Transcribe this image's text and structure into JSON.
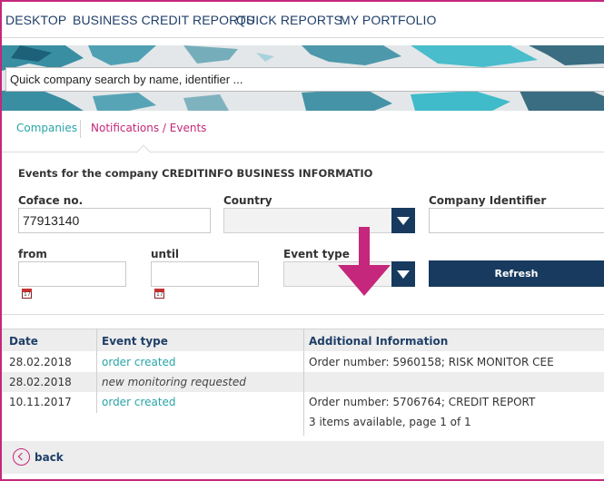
{
  "nav": {
    "items": [
      "DESKTOP",
      "BUSINESS CREDIT REPORTS",
      "QUICK REPORTS",
      "MY PORTFOLIO"
    ]
  },
  "search": {
    "placeholder": "Quick company search by name, identifier ..."
  },
  "tabs": {
    "companies": "Companies",
    "events": "Notifications / Events"
  },
  "filters": {
    "title": "Events for the company CREDITINFO BUSINESS INFORMATIO",
    "coface_label": "Coface no.",
    "coface_value": "77913140",
    "country_label": "Country",
    "company_id_label": "Company Identifier",
    "from_label": "from",
    "until_label": "until",
    "event_type_label": "Event type",
    "calendar_icon_text": "17",
    "refresh_label": "Refresh"
  },
  "table": {
    "headers": [
      "Date",
      "Event type",
      "Additional Information"
    ],
    "rows": [
      {
        "date": "28.02.2018",
        "event": "order created",
        "info": "Order number: 5960158; RISK MONITOR CEE"
      },
      {
        "date": "28.02.2018",
        "event": "new monitoring requested",
        "info": ""
      },
      {
        "date": "10.11.2017",
        "event": "order created",
        "info": "Order number: 5706764; CREDIT REPORT"
      }
    ],
    "pagination": "3 items available, page 1 of 1"
  },
  "footer": {
    "back_label": "back"
  },
  "colors": {
    "accent": "#c4277b",
    "navy": "#173a5e",
    "teal": "#2aa5a8"
  }
}
